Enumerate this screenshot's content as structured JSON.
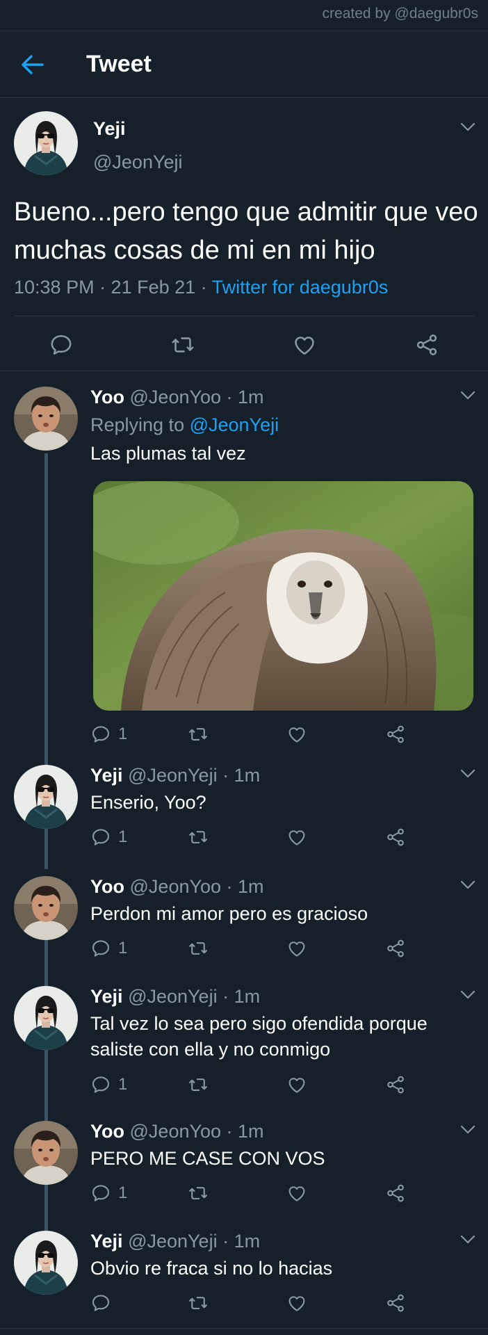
{
  "credit": "created by @daegubr0s",
  "header": {
    "title": "Tweet"
  },
  "main_tweet": {
    "name": "Yeji",
    "handle": "@JeonYeji",
    "text": "Bueno...pero tengo que admitir que veo muchas cosas de mi en mi hijo",
    "time": "10:38 PM · 21 Feb 21",
    "via_sep": " · ",
    "source": "Twitter for daegubr0s"
  },
  "replies": [
    {
      "name": "Yoo",
      "handle": "@JeonYoo · 1m",
      "replying_label": "Replying to ",
      "replying_to": "@JeonYeji",
      "text": "Las plumas tal vez",
      "reply_count": "1",
      "image": "vulture-photo"
    },
    {
      "name": "Yeji",
      "handle": "@JeonYeji · 1m",
      "text": "Enserio, Yoo?",
      "reply_count": "1"
    },
    {
      "name": "Yoo",
      "handle": "@JeonYoo · 1m",
      "text": "Perdon mi amor pero es gracioso",
      "reply_count": "1"
    },
    {
      "name": "Yeji",
      "handle": "@JeonYeji · 1m",
      "text": "Tal vez lo sea pero sigo ofendida porque saliste con ella y no conmigo",
      "reply_count": "1"
    },
    {
      "name": "Yoo",
      "handle": "@JeonYoo · 1m",
      "text": "PERO ME CASE CON VOS",
      "reply_count": "1"
    },
    {
      "name": "Yeji",
      "handle": "@JeonYeji · 1m",
      "text": "Obvio re fraca si no lo hacias",
      "reply_count": ""
    }
  ],
  "icons": {
    "reply": "reply-icon",
    "retweet": "retweet-icon",
    "like": "heart-icon",
    "share": "share-icon",
    "back": "back-arrow-icon",
    "more": "chevron-down-icon"
  },
  "colors": {
    "background": "#15202b",
    "accent": "#1da1f2",
    "muted": "#8899a6",
    "divider": "#2b3845"
  }
}
